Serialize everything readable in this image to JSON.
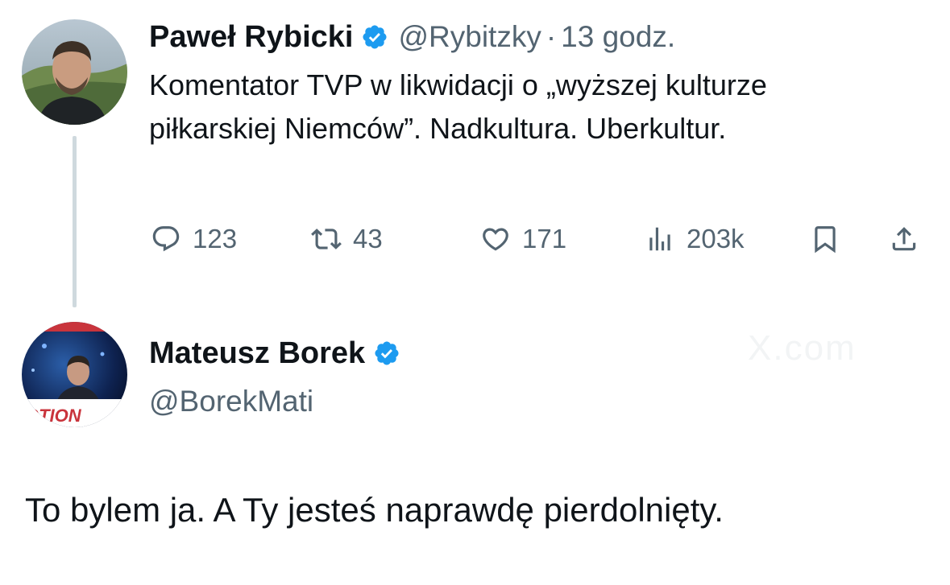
{
  "tweet": {
    "author_name": "Paweł Rybicki",
    "handle": "@Rybitzky",
    "separator": "·",
    "time": "13 godz.",
    "text": "Komentator TVP w likwidacji o „wyższej kulturze piłkarskiej Niemców”. Nadkultura. Uberkultur.",
    "stats": {
      "replies": "123",
      "retweets": "43",
      "likes": "171",
      "views": "203k"
    }
  },
  "reply": {
    "author_name": "Mateusz Borek",
    "handle": "@BorekMati",
    "text": "To bylem ja. A Ty jesteś naprawdę pierdolnięty."
  },
  "watermark": "X.com",
  "avatar2_banner_text": "OTION",
  "colors": {
    "primary_text": "#0f1419",
    "secondary_text": "#536471",
    "verified_blue": "#1d9bf0",
    "thread_line": "#cfd9de"
  },
  "icons": {
    "reply": "reply-icon",
    "retweet": "retweet-icon",
    "like": "heart-icon",
    "views": "views-icon",
    "bookmark": "bookmark-icon",
    "share": "share-icon",
    "verified": "verified-badge-icon"
  }
}
